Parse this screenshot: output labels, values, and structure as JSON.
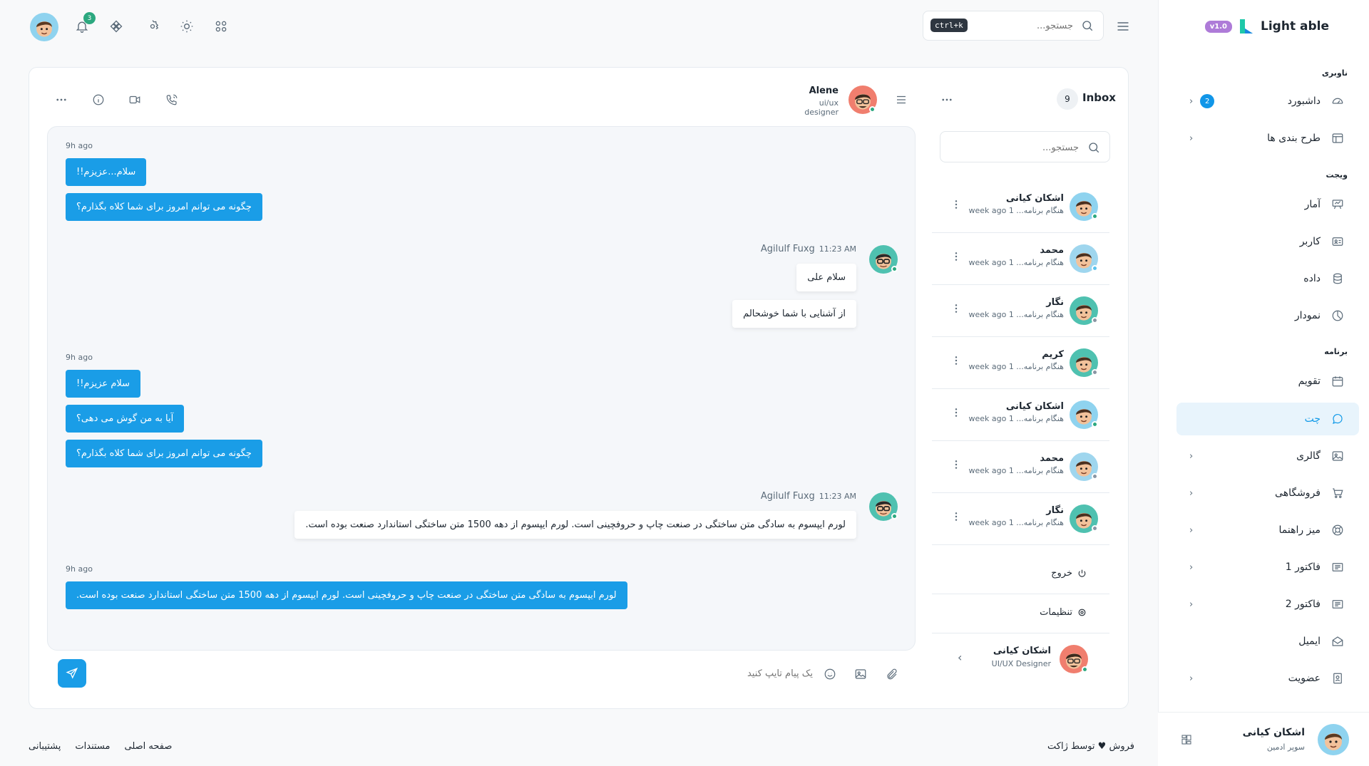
{
  "sidebar": {
    "version": "v1.0",
    "brand": "Light able",
    "sections": {
      "nav": "ناوبری",
      "widget": "ویجت",
      "app": "برنامه"
    },
    "items": [
      {
        "label": "داشبورد",
        "icon": "dashboard-icon",
        "badge": "2"
      },
      {
        "label": "طرح بندی ها",
        "icon": "layout-icon"
      },
      {
        "label": "آمار",
        "icon": "stats-icon"
      },
      {
        "label": "کاربر",
        "icon": "user-card-icon"
      },
      {
        "label": "داده",
        "icon": "database-icon"
      },
      {
        "label": "نمودار",
        "icon": "chart-icon"
      },
      {
        "label": "تقویم",
        "icon": "calendar-icon"
      },
      {
        "label": "چت",
        "icon": "chat-icon",
        "active": true
      },
      {
        "label": "گالری",
        "icon": "gallery-icon"
      },
      {
        "label": "فروشگاهی",
        "icon": "cart-icon"
      },
      {
        "label": "میز راهنما",
        "icon": "helpdesk-icon"
      },
      {
        "label": "فاکتور 1",
        "icon": "invoice-icon"
      },
      {
        "label": "فاکتور 2",
        "icon": "invoice-icon"
      },
      {
        "label": "ایمیل",
        "icon": "mail-icon"
      },
      {
        "label": "عضویت",
        "icon": "membership-icon"
      }
    ],
    "user": {
      "name": "اشکان کیانی",
      "role": "سوپر ادمین"
    }
  },
  "header": {
    "search_placeholder": "جستجو...",
    "shortcut": "ctrl+k",
    "notif_count": "3"
  },
  "inbox": {
    "title": "Inbox",
    "count": "9",
    "search_placeholder": "جستجو...",
    "contacts": [
      {
        "name": "اشکان کیانی",
        "sub": "هنگام برنامه... 1 week ago",
        "status": "#2ca87f"
      },
      {
        "name": "محمد",
        "sub": "هنگام برنامه... 1 week ago",
        "status": "#5bc3ee"
      },
      {
        "name": "نگار",
        "sub": "هنگام برنامه... 1 week ago",
        "status": "#8996a4"
      },
      {
        "name": "کریم",
        "sub": "هنگام برنامه... 1 week ago",
        "status": "#8996a4"
      },
      {
        "name": "اشکان کیانی",
        "sub": "هنگام برنامه... 1 week ago",
        "status": "#2ca87f"
      },
      {
        "name": "محمد",
        "sub": "هنگام برنامه... 1 week ago",
        "status": "#8996a4"
      },
      {
        "name": "نگار",
        "sub": "هنگام برنامه... 1 week ago",
        "status": "#8996a4"
      }
    ],
    "logout": "خروج",
    "settings": "تنظیمات",
    "me": {
      "name": "اشکان کیانی",
      "role": "UI/UX Designer"
    }
  },
  "chat": {
    "peer": {
      "name": "Alene",
      "role": "ui/ux designer"
    },
    "groups": [
      {
        "time": "9h ago",
        "messages": [
          "سلام...عزیزم!!",
          "چگونه می توانم امروز برای شما کلاه بگذارم؟"
        ]
      },
      {
        "sender": "Agilulf Fuxg",
        "time": "11:23 AM",
        "messages": [
          "سلام علی",
          "از آشنایی با شما خوشحالم"
        ]
      },
      {
        "time": "9h ago",
        "messages": [
          "سلام عزیزم!!",
          "آیا به من گوش می دهی؟",
          "چگونه می توانم امروز برای شما کلاه بگذارم؟"
        ]
      },
      {
        "sender": "Agilulf Fuxg",
        "time": "11:23 AM",
        "messages": [
          "لورم ایپسوم به سادگی متن ساختگی در صنعت چاپ و حروفچینی است. لورم ایپسوم از دهه 1500 متن ساختگی استاندارد صنعت بوده است."
        ]
      },
      {
        "time": "9h ago",
        "messages": [
          "لورم ایپسوم به سادگی متن ساختگی در صنعت چاپ و حروفچینی است. لورم ایپسوم از دهه 1500 متن ساختگی استاندارد صنعت بوده است."
        ]
      }
    ],
    "input_placeholder": "یک پیام تایپ کنید"
  },
  "footer": {
    "credit": "فروش ♥ توسط ژاکت",
    "links": [
      "صفحه اصلی",
      "مستندات",
      "پشتیبانی"
    ]
  },
  "colors": {
    "primary": "#1a9de7",
    "online": "#2ca87f",
    "brand_badge": "#ae7bd8"
  }
}
